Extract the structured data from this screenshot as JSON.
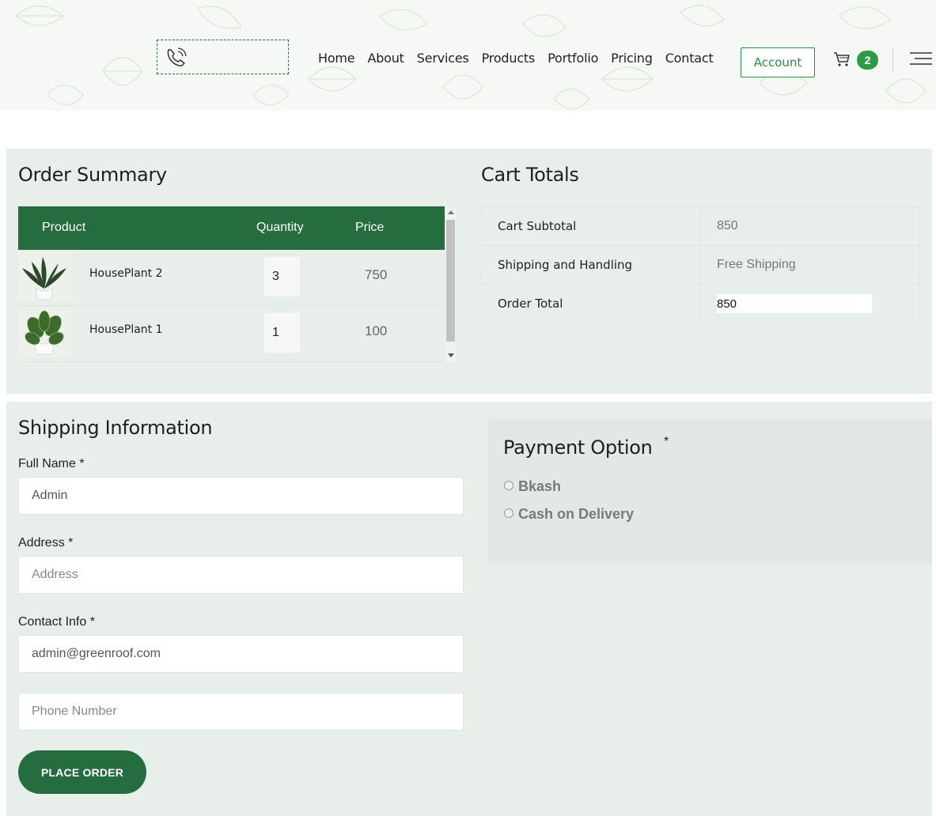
{
  "header": {
    "nav": [
      "Home",
      "About",
      "Services",
      "Products",
      "Portfolio",
      "Pricing",
      "Contact"
    ],
    "account_label": "Account",
    "cart_count": "2",
    "icons": {
      "phone": "phone-icon",
      "cart": "cart-icon",
      "menu": "hamburger-menu-icon"
    }
  },
  "order_summary": {
    "title": "Order Summary",
    "columns": [
      "Product",
      "Quantity",
      "Price"
    ],
    "rows": [
      {
        "name": "HousePlant 2",
        "quantity": "3",
        "price": "750"
      },
      {
        "name": "HousePlant 1",
        "quantity": "1",
        "price": "100"
      }
    ]
  },
  "cart_totals": {
    "title": "Cart Totals",
    "subtotal_label": "Cart Subtotal",
    "subtotal_value": "850",
    "shipping_label": "Shipping and Handling",
    "shipping_value": "Free Shipping",
    "total_label": "Order Total",
    "total_value": "850"
  },
  "shipping": {
    "title": "Shipping Information",
    "full_name_label": "Full Name *",
    "full_name_value": "Admin",
    "address_label": "Address *",
    "address_placeholder": "Address",
    "contact_label": "Contact Info *",
    "contact_value": "admin@greenroof.com",
    "phone_placeholder": "Phone Number",
    "submit_label": "PLACE ORDER"
  },
  "payment": {
    "title": "Payment Option",
    "required_mark": "*",
    "options": [
      "Bkash",
      "Cash on Delivery"
    ]
  },
  "colors": {
    "brand_green": "#256d3e",
    "accent_green": "#2f8a47",
    "panel_bg": "#e8eeea"
  }
}
